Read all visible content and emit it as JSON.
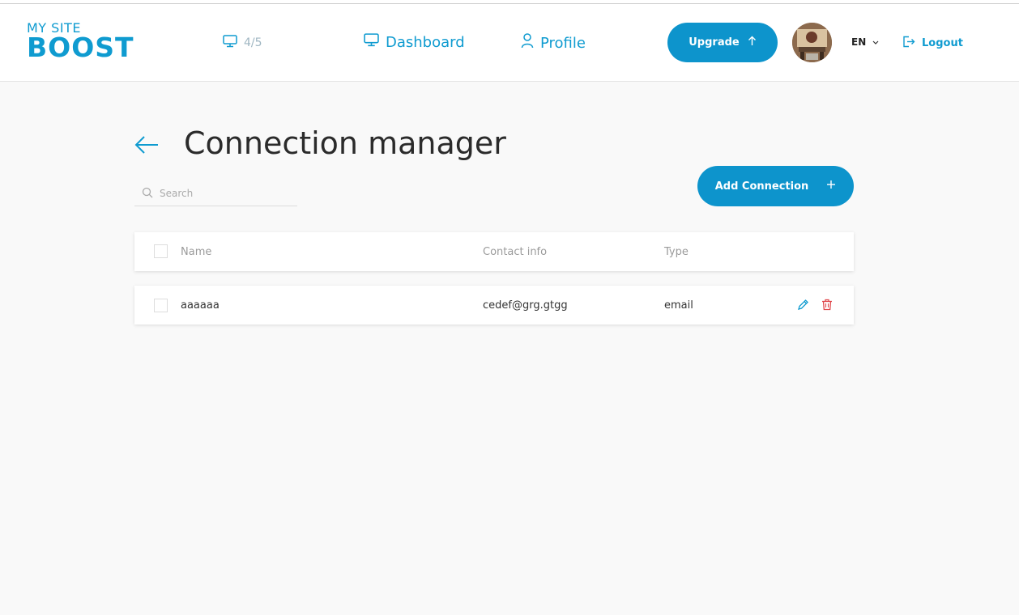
{
  "header": {
    "logo_line1": "MY SITE",
    "logo_line2": "BOOST",
    "site_counter": "4/5",
    "nav": {
      "dashboard": "Dashboard",
      "profile": "Profile"
    },
    "upgrade_label": "Upgrade",
    "language": "EN",
    "logout_label": "Logout"
  },
  "page": {
    "title": "Connection manager",
    "search_placeholder": "Search",
    "add_button_label": "Add Connection"
  },
  "table": {
    "columns": {
      "name": "Name",
      "contact": "Contact info",
      "type": "Type"
    },
    "rows": [
      {
        "name": "aaaaaa",
        "contact": "cedef@grg.gtgg",
        "type": "email"
      }
    ]
  },
  "colors": {
    "accent": "#0d94cc",
    "danger": "#e0474c"
  }
}
